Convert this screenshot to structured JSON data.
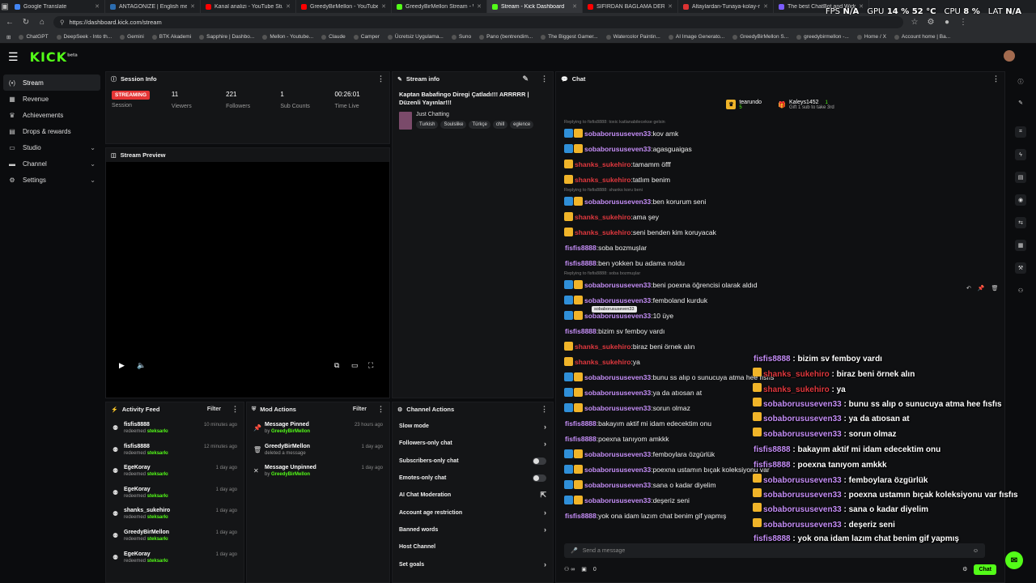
{
  "browser": {
    "tabs": [
      {
        "label": "Google Translate",
        "color": "#4285f4",
        "active": false
      },
      {
        "label": "ANTAGONIZE | English meaning -",
        "color": "#2b6cb0",
        "active": false
      },
      {
        "label": "Kanal analizi - YouTube Studio",
        "color": "#ff0000",
        "active": false
      },
      {
        "label": "GreedyBirMellon - YouTube",
        "color": "#ff0000",
        "active": false
      },
      {
        "label": "GreedyBirMellon Stream - Watch",
        "color": "#53fc18",
        "active": false
      },
      {
        "label": "Stream - Kick Dashboard",
        "color": "#53fc18",
        "active": true
      },
      {
        "label": "SIFIRDAN BAĞLAMA DERSLERİ 6",
        "color": "#ff0000",
        "active": false
      },
      {
        "label": "Altaylardan-Tunaya-kolay-nota-p",
        "color": "#d33",
        "active": false
      },
      {
        "label": "The best ChatBot and Widgets fo",
        "color": "#7b5cff",
        "active": false
      }
    ],
    "url": "https://dashboard.kick.com/stream",
    "bookmarks": [
      "ChatGPT",
      "DeepSeek - Into th...",
      "Gemini",
      "BTK Akademi",
      "Sapphire | Dashbo...",
      "Mellon - Youtube...",
      "Claude",
      "Camper",
      "Ücretsiz Uygulama...",
      "Suno",
      "Pano (bentrendim...",
      "The Biggest Gamer...",
      "Watercolor Paintin...",
      "AI Image Generato...",
      "GreedyBirMellon S...",
      "greedybirmellon -...",
      "Home / X",
      "Account home | Ba..."
    ]
  },
  "perf_overlay": {
    "fps_label": "FPS",
    "fps": "N/A",
    "gpu_label": "GPU",
    "gpu": "14 % 52 °C",
    "cpu_label": "CPU",
    "cpu": "8 %",
    "lat_label": "LAT",
    "lat": "N/A"
  },
  "header": {
    "logo": "KICK",
    "logo_sup": "beta"
  },
  "sidebar": {
    "items": [
      {
        "label": "Stream",
        "icon": "(•)",
        "active": true,
        "chevron": false
      },
      {
        "label": "Revenue",
        "icon": "▦",
        "active": false,
        "chevron": false
      },
      {
        "label": "Achievements",
        "icon": "♛",
        "active": false,
        "chevron": false
      },
      {
        "label": "Drops & rewards",
        "icon": "▤",
        "active": false,
        "chevron": false
      },
      {
        "label": "Studio",
        "icon": "▭",
        "active": false,
        "chevron": true
      },
      {
        "label": "Channel",
        "icon": "▬",
        "active": false,
        "chevron": true
      },
      {
        "label": "Settings",
        "icon": "⚙",
        "active": false,
        "chevron": true
      }
    ]
  },
  "session": {
    "title": "Session Info",
    "status": "STREAMING",
    "status_label": "Session",
    "stats": [
      {
        "value": "11",
        "label": "Viewers"
      },
      {
        "value": "221",
        "label": "Followers"
      },
      {
        "value": "1",
        "label": "Sub Counts"
      },
      {
        "value": "00:26:01",
        "label": "Time Live"
      }
    ]
  },
  "preview": {
    "title": "Stream Preview"
  },
  "stream_info": {
    "title": "Stream info",
    "stream_title": "Kaptan Babafingo Diregi Çatladı!!! ARRRRR | Düzenli Yayınlar!!!",
    "category": "Just Chatting",
    "tags": [
      "Turkish",
      "Soulslike",
      "Türkçe",
      "chill",
      "eglence"
    ]
  },
  "activity_feed": {
    "title": "Activity Feed",
    "filter": "Filter",
    "items": [
      {
        "user": "fisfis8888",
        "action": "redeemed",
        "reward": "steksarkı",
        "time": "10 minutes ago"
      },
      {
        "user": "fisfis8888",
        "action": "redeemed",
        "reward": "steksarkı",
        "time": "12 minutes ago"
      },
      {
        "user": "EgeKoray",
        "action": "redeemed",
        "reward": "steksarkı",
        "time": "1 day ago"
      },
      {
        "user": "EgeKoray",
        "action": "redeemed",
        "reward": "steksarkı",
        "time": "1 day ago"
      },
      {
        "user": "shanks_sukehiro",
        "action": "redeemed",
        "reward": "steksarkı",
        "time": "1 day ago"
      },
      {
        "user": "GreedyBirMellon",
        "action": "redeemed",
        "reward": "steksarkı",
        "time": "1 day ago"
      },
      {
        "user": "EgeKoray",
        "action": "redeemed",
        "reward": "steksarkı",
        "time": "1 day ago"
      }
    ]
  },
  "mod_actions": {
    "title": "Mod Actions",
    "filter": "Filter",
    "items": [
      {
        "action": "Message Pinned",
        "detail_prefix": "by",
        "detail_user": "GreedyBirMellon",
        "time": "23 hours ago",
        "icon": "pin-icon",
        "glyph": "📌"
      },
      {
        "action": "GreedyBirMellon",
        "detail_prefix": "deleted a message",
        "detail_user": "",
        "time": "1 day ago",
        "icon": "trash-icon",
        "glyph": "🗑"
      },
      {
        "action": "Message Unpinned",
        "detail_prefix": "by",
        "detail_user": "GreedyBirMellon",
        "time": "1 day ago",
        "icon": "unpin-icon",
        "glyph": "✕"
      }
    ]
  },
  "channel_actions": {
    "title": "Channel Actions",
    "items": [
      {
        "label": "Slow mode",
        "control": "chevron"
      },
      {
        "label": "Followers-only chat",
        "control": "chevron"
      },
      {
        "label": "Subscribers-only chat",
        "control": "toggle"
      },
      {
        "label": "Emotes-only chat",
        "control": "toggle"
      },
      {
        "label": "AI Chat Moderation",
        "control": "external"
      },
      {
        "label": "Account age restriction",
        "control": "chevron"
      },
      {
        "label": "Banned words",
        "control": "chevron"
      },
      {
        "label": "Host Channel",
        "control": "none"
      },
      {
        "label": "Set goals",
        "control": "chevron"
      }
    ]
  },
  "chat": {
    "title": "Chat",
    "gifter1": {
      "name": "tearundo",
      "count": "5"
    },
    "gifter2": {
      "name": "Kaleys1452",
      "count": "1",
      "note": "Gift 1 sub to take 3rd"
    },
    "messages": [
      {
        "reply": "Replying to fisfis8888: toxic katlanabilecekse gelsin"
      },
      {
        "user": "sobaborususeven33",
        "color": "purple",
        "badges": [
          "b1",
          "b2"
        ],
        "text": "kov amk"
      },
      {
        "user": "sobaborususeven33",
        "color": "purple",
        "badges": [
          "b1",
          "b2"
        ],
        "text": "agasguaigas"
      },
      {
        "user": "shanks_sukehiro",
        "color": "red",
        "badges": [
          "b2"
        ],
        "text": "tamamm öfff"
      },
      {
        "user": "shanks_sukehiro",
        "color": "red",
        "badges": [
          "b2"
        ],
        "text": "tatlım benim"
      },
      {
        "reply": "Replying to fisfis8888: shanks koru beni"
      },
      {
        "user": "sobaborususeven33",
        "color": "purple",
        "badges": [
          "b1",
          "b2"
        ],
        "text": "ben korurum seni"
      },
      {
        "user": "shanks_sukehiro",
        "color": "red",
        "badges": [
          "b2"
        ],
        "text": "ama şey"
      },
      {
        "user": "shanks_sukehiro",
        "color": "red",
        "badges": [
          "b2"
        ],
        "text": "seni benden kim koruyacak"
      },
      {
        "user": "fisfis8888",
        "color": "purple",
        "badges": [],
        "text": "soba bozmuşlar"
      },
      {
        "user": "fisfis8888",
        "color": "purple",
        "badges": [],
        "text": "ben yokken bu adama noldu"
      },
      {
        "reply": "Replying to fisfis8888: soba bozmuşlar"
      },
      {
        "user": "sobaborususeven33",
        "color": "purple",
        "badges": [
          "b1",
          "b2"
        ],
        "text": "beni poexna öğrencisi olarak aldıd"
      },
      {
        "user": "sobaborususeven33",
        "color": "purple",
        "badges": [
          "b1",
          "b2"
        ],
        "text": "femboland kurduk"
      },
      {
        "user": "sobaborususeven33",
        "color": "purple",
        "badges": [
          "b1",
          "b2"
        ],
        "text": "10 üye"
      },
      {
        "user": "fisfis8888",
        "color": "purple",
        "badges": [],
        "text": "bizim sv femboy vardı"
      },
      {
        "user": "shanks_sukehiro",
        "color": "red",
        "badges": [
          "b2"
        ],
        "text": "biraz beni örnek alın"
      },
      {
        "user": "shanks_sukehiro",
        "color": "red",
        "badges": [
          "b2"
        ],
        "text": "ya"
      },
      {
        "user": "sobaborususeven33",
        "color": "purple",
        "badges": [
          "b1",
          "b2"
        ],
        "text": "bunu ss alıp o sunucuya atma hee fısfıs"
      },
      {
        "user": "sobaborususeven33",
        "color": "purple",
        "badges": [
          "b1",
          "b2"
        ],
        "text": "ya da atıosan at"
      },
      {
        "user": "sobaborususeven33",
        "color": "purple",
        "badges": [
          "b1",
          "b2"
        ],
        "text": "sorun olmaz"
      },
      {
        "user": "fisfis8888",
        "color": "purple",
        "badges": [],
        "text": "bakayım aktif mi idam edecektim onu"
      },
      {
        "user": "fisfis8888",
        "color": "purple",
        "badges": [],
        "text": "poexna tanıyom amkkk"
      },
      {
        "user": "sobaborususeven33",
        "color": "purple",
        "badges": [
          "b1",
          "b2"
        ],
        "text": "femboylara özgürlük"
      },
      {
        "user": "sobaborususeven33",
        "color": "purple",
        "badges": [
          "b1",
          "b2"
        ],
        "text": "poexna ustamın bıçak koleksiyonu var"
      },
      {
        "user": "sobaborususeven33",
        "color": "purple",
        "badges": [
          "b1",
          "b2"
        ],
        "text": "sana o kadar diyelim"
      },
      {
        "user": "sobaborususeven33",
        "color": "purple",
        "badges": [
          "b1",
          "b2"
        ],
        "text": "deşeriz seni"
      },
      {
        "user": "fisfis8888",
        "color": "purple",
        "badges": [],
        "text": "yok ona idam lazım chat benim gif yapmış"
      }
    ],
    "tooltip": "sobaborususeven33",
    "input_placeholder": "Send a message",
    "footer_count": "0",
    "send_label": "Chat"
  },
  "overlay_chat": [
    {
      "user": "fisfis8888",
      "color": "purple",
      "text": "bizim sv femboy vardı"
    },
    {
      "user": "shanks_sukehiro",
      "color": "red",
      "text": "biraz beni örnek alın"
    },
    {
      "user": "shanks_sukehiro",
      "color": "red",
      "text": "ya"
    },
    {
      "user": "sobaborususeven33",
      "color": "purple",
      "text": "bunu ss alıp o sunucuya atma hee fısfıs"
    },
    {
      "user": "sobaborususeven33",
      "color": "purple",
      "text": "ya da atıosan at"
    },
    {
      "user": "sobaborususeven33",
      "color": "purple",
      "text": "sorun olmaz"
    },
    {
      "user": "fisfis8888",
      "color": "purple",
      "text": "bakayım aktif mi idam edecektim onu"
    },
    {
      "user": "fisfis8888",
      "color": "purple",
      "text": "poexna tanıyom amkkk"
    },
    {
      "user": "sobaborususeven33",
      "color": "purple",
      "text": "femboylara özgürlük"
    },
    {
      "user": "sobaborususeven33",
      "color": "purple",
      "text": "poexna ustamın bıçak koleksiyonu var fısfıs"
    },
    {
      "user": "sobaborususeven33",
      "color": "purple",
      "text": "sana o kadar diyelim"
    },
    {
      "user": "sobaborususeven33",
      "color": "purple",
      "text": "deşeriz seni"
    },
    {
      "user": "fisfis8888",
      "color": "purple",
      "text": "yok ona idam lazım chat benim gif yapmış"
    }
  ],
  "colors": {
    "accent": "#53fc18",
    "live": "#e53535",
    "user_purple": "#c58ef7",
    "user_red": "#e0383e"
  }
}
